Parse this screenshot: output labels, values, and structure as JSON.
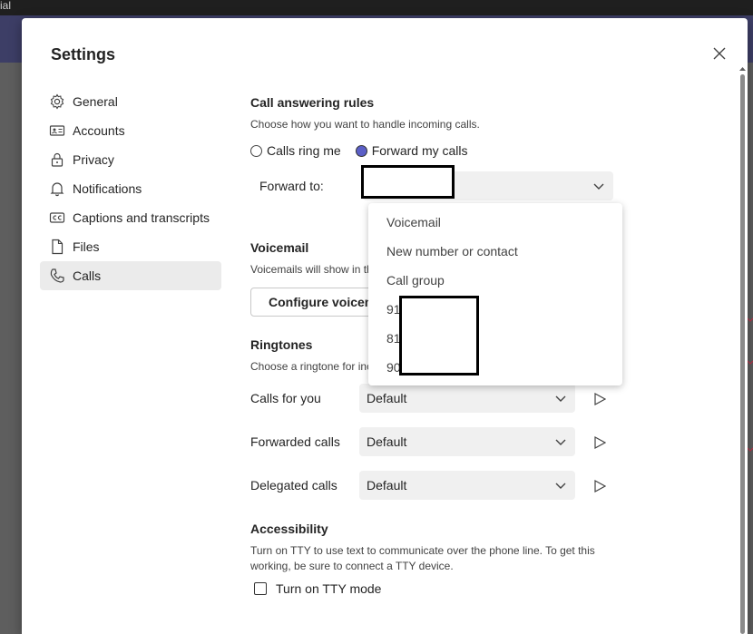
{
  "topbar": {
    "text": "ial"
  },
  "dialog": {
    "title": "Settings"
  },
  "nav": {
    "items": [
      {
        "label": "General",
        "icon": "gear-icon"
      },
      {
        "label": "Accounts",
        "icon": "id-card-icon"
      },
      {
        "label": "Privacy",
        "icon": "lock-icon"
      },
      {
        "label": "Notifications",
        "icon": "bell-icon"
      },
      {
        "label": "Captions and transcripts",
        "icon": "cc-icon"
      },
      {
        "label": "Files",
        "icon": "file-icon"
      },
      {
        "label": "Calls",
        "icon": "phone-icon",
        "active": true
      }
    ]
  },
  "call_answering": {
    "heading": "Call answering rules",
    "description": "Choose how you want to handle incoming calls.",
    "option_ring": "Calls ring me",
    "option_forward": "Forward my calls",
    "selected": "Forward my calls",
    "forward_to_label": "Forward to:"
  },
  "dropdown": {
    "items": [
      "Voicemail",
      "New number or contact",
      "Call group",
      "91",
      "81",
      "90"
    ]
  },
  "voicemail": {
    "heading": "Voicemail",
    "description": "Voicemails will show in th",
    "configure_button": "Configure voicem"
  },
  "ringtones": {
    "heading": "Ringtones",
    "description": "Choose a ringtone for inc",
    "rows": [
      {
        "label": "Calls for you",
        "value": "Default"
      },
      {
        "label": "Forwarded calls",
        "value": "Default"
      },
      {
        "label": "Delegated calls",
        "value": "Default"
      }
    ]
  },
  "accessibility": {
    "heading": "Accessibility",
    "description_line1": "Turn on TTY to use text to communicate over the phone line. To get this",
    "description_line2": "working, be sure to connect a TTY device.",
    "tty_label": "Turn on TTY mode",
    "tty_checked": false
  },
  "colors": {
    "accent": "#5b5fc7",
    "appbar": "#3d3e66"
  }
}
